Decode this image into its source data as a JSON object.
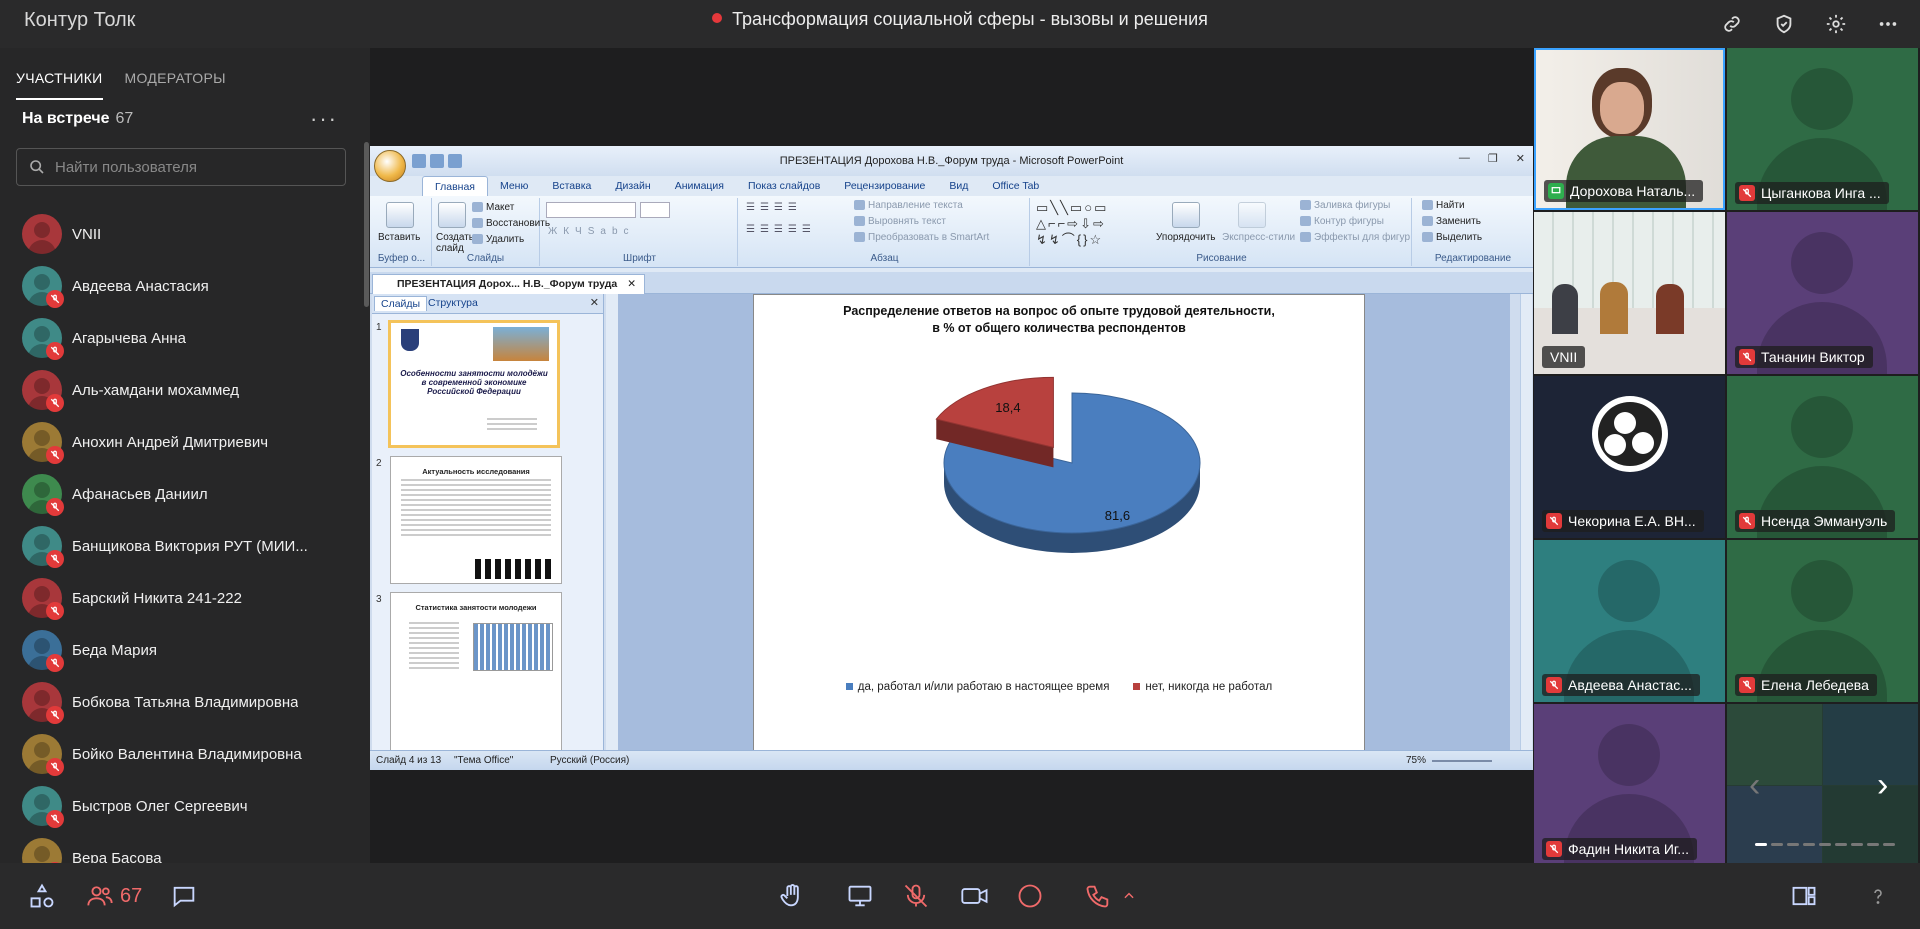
{
  "app": {
    "title": "Контур Толк"
  },
  "meeting": {
    "title": "Трансформация социальной сферы - вызовы и решения"
  },
  "sidebar": {
    "tabs": [
      {
        "label": "УЧАСТНИКИ"
      },
      {
        "label": "МОДЕРАТОРЫ"
      }
    ],
    "heading": "На встрече",
    "count": "67",
    "search_placeholder": "Найти пользователя",
    "participants": [
      {
        "name": "VNII",
        "color": "#a8373b",
        "muted": false
      },
      {
        "name": "Авдеева Анастасия",
        "color": "#3f8a87",
        "muted": true
      },
      {
        "name": "Агарычева Анна",
        "color": "#3f8a87",
        "muted": true
      },
      {
        "name": "Аль-хамдани мохаммед",
        "color": "#a8373b",
        "muted": true
      },
      {
        "name": "Анохин Андрей Дмитриевич",
        "color": "#9c7a35",
        "muted": true
      },
      {
        "name": "Афанасьев Даниил",
        "color": "#3e8a4e",
        "muted": true
      },
      {
        "name": "Банщикова Виктория РУТ (МИИ...",
        "color": "#3f8a87",
        "muted": true
      },
      {
        "name": "Барский Никита 241-222",
        "color": "#a8373b",
        "muted": true
      },
      {
        "name": "Беда Мария",
        "color": "#3b6f98",
        "muted": true
      },
      {
        "name": "Бобкова Татьяна Владимировна",
        "color": "#a8373b",
        "muted": true
      },
      {
        "name": "Бойко Валентина Владимировна",
        "color": "#9c7a35",
        "muted": true
      },
      {
        "name": "Быстров Олег Сергеевич",
        "color": "#3f8a87",
        "muted": true
      },
      {
        "name": "Вера Басова",
        "color": "#9c7a35",
        "muted": true
      }
    ]
  },
  "ppt": {
    "window_title": "ПРЕЗЕНТАЦИЯ Дорохова Н.В._Форум труда - Microsoft PowerPoint",
    "ribbon_tabs": [
      "Главная",
      "Меню",
      "Вставка",
      "Дизайн",
      "Анимация",
      "Показ слайдов",
      "Рецензирование",
      "Вид",
      "Office Tab"
    ],
    "groups": {
      "clipboard": "Буфер о...",
      "slides": "Слайды",
      "font": "Шрифт",
      "paragraph": "Абзац",
      "drawing": "Рисование",
      "editing": "Редактирование"
    },
    "buttons": {
      "paste": "Вставить",
      "new_slide": "Создать слайд",
      "layout": "Макет",
      "restore": "Восстановить",
      "delete": "Удалить",
      "text_direction": "Направление текста",
      "align_text": "Выровнять текст",
      "smartart": "Преобразовать в SmartArt",
      "arrange": "Упорядочить",
      "quick_styles": "Экспресс-стили",
      "shape_fill": "Заливка фигуры",
      "shape_outline": "Контур фигуры",
      "shape_effects": "Эффекты для фигур",
      "find": "Найти",
      "replace": "Заменить",
      "select": "Выделить"
    },
    "doc_tab": "ПРЕЗЕНТАЦИЯ Дорох... Н.В._Форум труда",
    "panel_tabs": [
      "Слайды",
      "Структура"
    ],
    "thumbnails": [
      {
        "num": "1",
        "title": "Особенности занятости молодёжи в современной экономике Российской Федерации"
      },
      {
        "num": "2",
        "title": "Актуальность исследования"
      },
      {
        "num": "3",
        "title": "Статистика занятости молодежи"
      }
    ],
    "status": {
      "slide": "Слайд 4 из 13",
      "theme": "\"Тема Office\"",
      "lang": "Русский (Россия)",
      "zoom": "75%"
    }
  },
  "chart_data": {
    "type": "pie",
    "title": "Распределение ответов на вопрос об опыте трудовой деятельности,\nв % от общего количества респондентов",
    "series": [
      {
        "name": "да, работал и/или работаю в настоящее время",
        "value": 81.6,
        "label": "81,6",
        "color": "#4a7ebf"
      },
      {
        "name": "нет, никогда не работал",
        "value": 18.4,
        "label": "18,4",
        "color": "#b8413e"
      }
    ],
    "legend_position": "bottom"
  },
  "video": {
    "tiles": [
      {
        "name": "Дорохова Наталь...",
        "bg": "#e9e6e2",
        "mic": "screen",
        "kind": "camera-speaker"
      },
      {
        "name": "Цыганкова Инга ...",
        "bg": "#2f6b45",
        "mic": "muted",
        "kind": "avatar"
      },
      {
        "name": "VNII",
        "bg": "#cfd8d6",
        "mic": "none",
        "kind": "camera-panel"
      },
      {
        "name": "Тананин Виктор",
        "bg": "#5a3f78",
        "mic": "muted",
        "kind": "avatar"
      },
      {
        "name": "Чекорина Е.А. ВН...",
        "bg": "#1d2436",
        "mic": "muted",
        "kind": "obs"
      },
      {
        "name": "Нсенда Эммануэль",
        "bg": "#2f6b45",
        "mic": "muted",
        "kind": "avatar"
      },
      {
        "name": "Авдеева Анастас...",
        "bg": "#2e7f7f",
        "mic": "muted",
        "kind": "avatar"
      },
      {
        "name": "Елена Лебедева",
        "bg": "#2f6b45",
        "mic": "muted",
        "kind": "avatar"
      },
      {
        "name": "Фадин Никита Иг...",
        "bg": "#5a3f78",
        "mic": "muted",
        "kind": "avatar"
      },
      {
        "name": "",
        "bg": "#263c33",
        "mic": "none",
        "kind": "more"
      }
    ]
  },
  "bottom": {
    "participants_count": "67"
  }
}
